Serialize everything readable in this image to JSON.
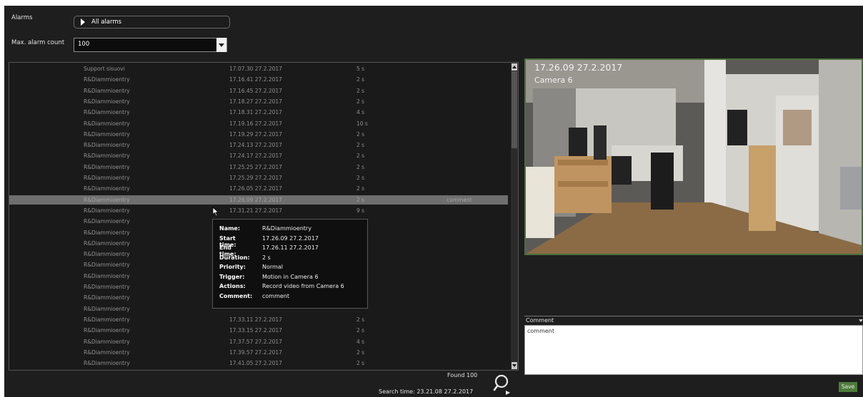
{
  "filters": {
    "alarms_label": "Alarms",
    "alarms_value": "All alarms",
    "max_count_label": "Max. alarm count",
    "max_count_value": "100"
  },
  "alarm_list": {
    "rows": [
      {
        "name": "Support sisuovi",
        "time": "17.07.30  27.2.2017",
        "duration": "5 s",
        "comment": ""
      },
      {
        "name": "R&Diammioentry",
        "time": "17.16.41  27.2.2017",
        "duration": "2 s",
        "comment": ""
      },
      {
        "name": "R&Diammioentry",
        "time": "17.16.45  27.2.2017",
        "duration": "2 s",
        "comment": ""
      },
      {
        "name": "R&Diammioentry",
        "time": "17.18.27  27.2.2017",
        "duration": "2 s",
        "comment": ""
      },
      {
        "name": "R&Diammioentry",
        "time": "17.18.31  27.2.2017",
        "duration": "4 s",
        "comment": ""
      },
      {
        "name": "R&Diammioentry",
        "time": "17.19.16  27.2.2017",
        "duration": "10 s",
        "comment": ""
      },
      {
        "name": "R&Diammioentry",
        "time": "17.19.29  27.2.2017",
        "duration": "2 s",
        "comment": ""
      },
      {
        "name": "R&Diammioentry",
        "time": "17.24.13  27.2.2017",
        "duration": "2 s",
        "comment": ""
      },
      {
        "name": "R&Diammioentry",
        "time": "17.24.17  27.2.2017",
        "duration": "2 s",
        "comment": ""
      },
      {
        "name": "R&Diammioentry",
        "time": "17.25.25  27.2.2017",
        "duration": "2 s",
        "comment": ""
      },
      {
        "name": "R&Diammioentry",
        "time": "17.25.29  27.2.2017",
        "duration": "2 s",
        "comment": ""
      },
      {
        "name": "R&Diammioentry",
        "time": "17.26.05  27.2.2017",
        "duration": "2 s",
        "comment": ""
      },
      {
        "name": "R&Diammioentry",
        "time": "17.26.09  27.2.2017",
        "duration": "2 s",
        "comment": "comment"
      },
      {
        "name": "R&Diammioentry",
        "time": "17.31.21  27.2.2017",
        "duration": "9 s",
        "comment": ""
      },
      {
        "name": "R&Diammioentry",
        "time": "",
        "duration": "",
        "comment": ""
      },
      {
        "name": "R&Diammioentry",
        "time": "",
        "duration": "",
        "comment": ""
      },
      {
        "name": "R&Diammioentry",
        "time": "",
        "duration": "",
        "comment": ""
      },
      {
        "name": "R&Diammioentry",
        "time": "",
        "duration": "",
        "comment": ""
      },
      {
        "name": "R&Diammioentry",
        "time": "",
        "duration": "",
        "comment": ""
      },
      {
        "name": "R&Diammioentry",
        "time": "",
        "duration": "",
        "comment": ""
      },
      {
        "name": "R&Diammioentry",
        "time": "",
        "duration": "",
        "comment": ""
      },
      {
        "name": "R&Diammioentry",
        "time": "",
        "duration": "",
        "comment": ""
      },
      {
        "name": "R&Diammioentry",
        "time": "",
        "duration": "",
        "comment": ""
      },
      {
        "name": "R&Diammioentry",
        "time": "17.33.11  27.2.2017",
        "duration": "2 s",
        "comment": ""
      },
      {
        "name": "R&Diammioentry",
        "time": "17.33.15  27.2.2017",
        "duration": "2 s",
        "comment": ""
      },
      {
        "name": "R&Diammioentry",
        "time": "17.37.57  27.2.2017",
        "duration": "4 s",
        "comment": ""
      },
      {
        "name": "R&Diammioentry",
        "time": "17.39.57  27.2.2017",
        "duration": "2 s",
        "comment": ""
      },
      {
        "name": "R&Diammioentry",
        "time": "17.41.05  27.2.2017",
        "duration": "2 s",
        "comment": ""
      }
    ],
    "selected_index": 12
  },
  "tooltip": {
    "fields": [
      {
        "key": "Name:",
        "value": "R&Diammioentry"
      },
      {
        "key": "Start time:",
        "value": "17.26.09  27.2.2017"
      },
      {
        "key": "End time:",
        "value": "17.26.11  27.2.2017"
      },
      {
        "key": "Duration:",
        "value": "2 s"
      },
      {
        "key": "Priority:",
        "value": "Normal"
      },
      {
        "key": "Trigger:",
        "value": "Motion in Camera 6"
      },
      {
        "key": "Actions:",
        "value": "Record video from Camera 6"
      },
      {
        "key": "Comment:",
        "value": "comment"
      }
    ]
  },
  "footer": {
    "found": "Found 100",
    "search_time": "Search time: 23.21.08  27.2.2017"
  },
  "camera": {
    "timestamp": "17.26.09  27.2.2017",
    "name": "Camera 6"
  },
  "comment": {
    "label": "Comment",
    "text": "comment"
  },
  "save_label": "Save",
  "colors": {
    "background": "#1e1e1e",
    "selected_row": "#6e6e6e",
    "accent_green": "#4d7a3a",
    "camera_border": "#4c6e3c"
  },
  "icons": [
    "play-triangle-icon",
    "chevron-down-icon",
    "search-icon",
    "mouse-cursor-icon"
  ]
}
